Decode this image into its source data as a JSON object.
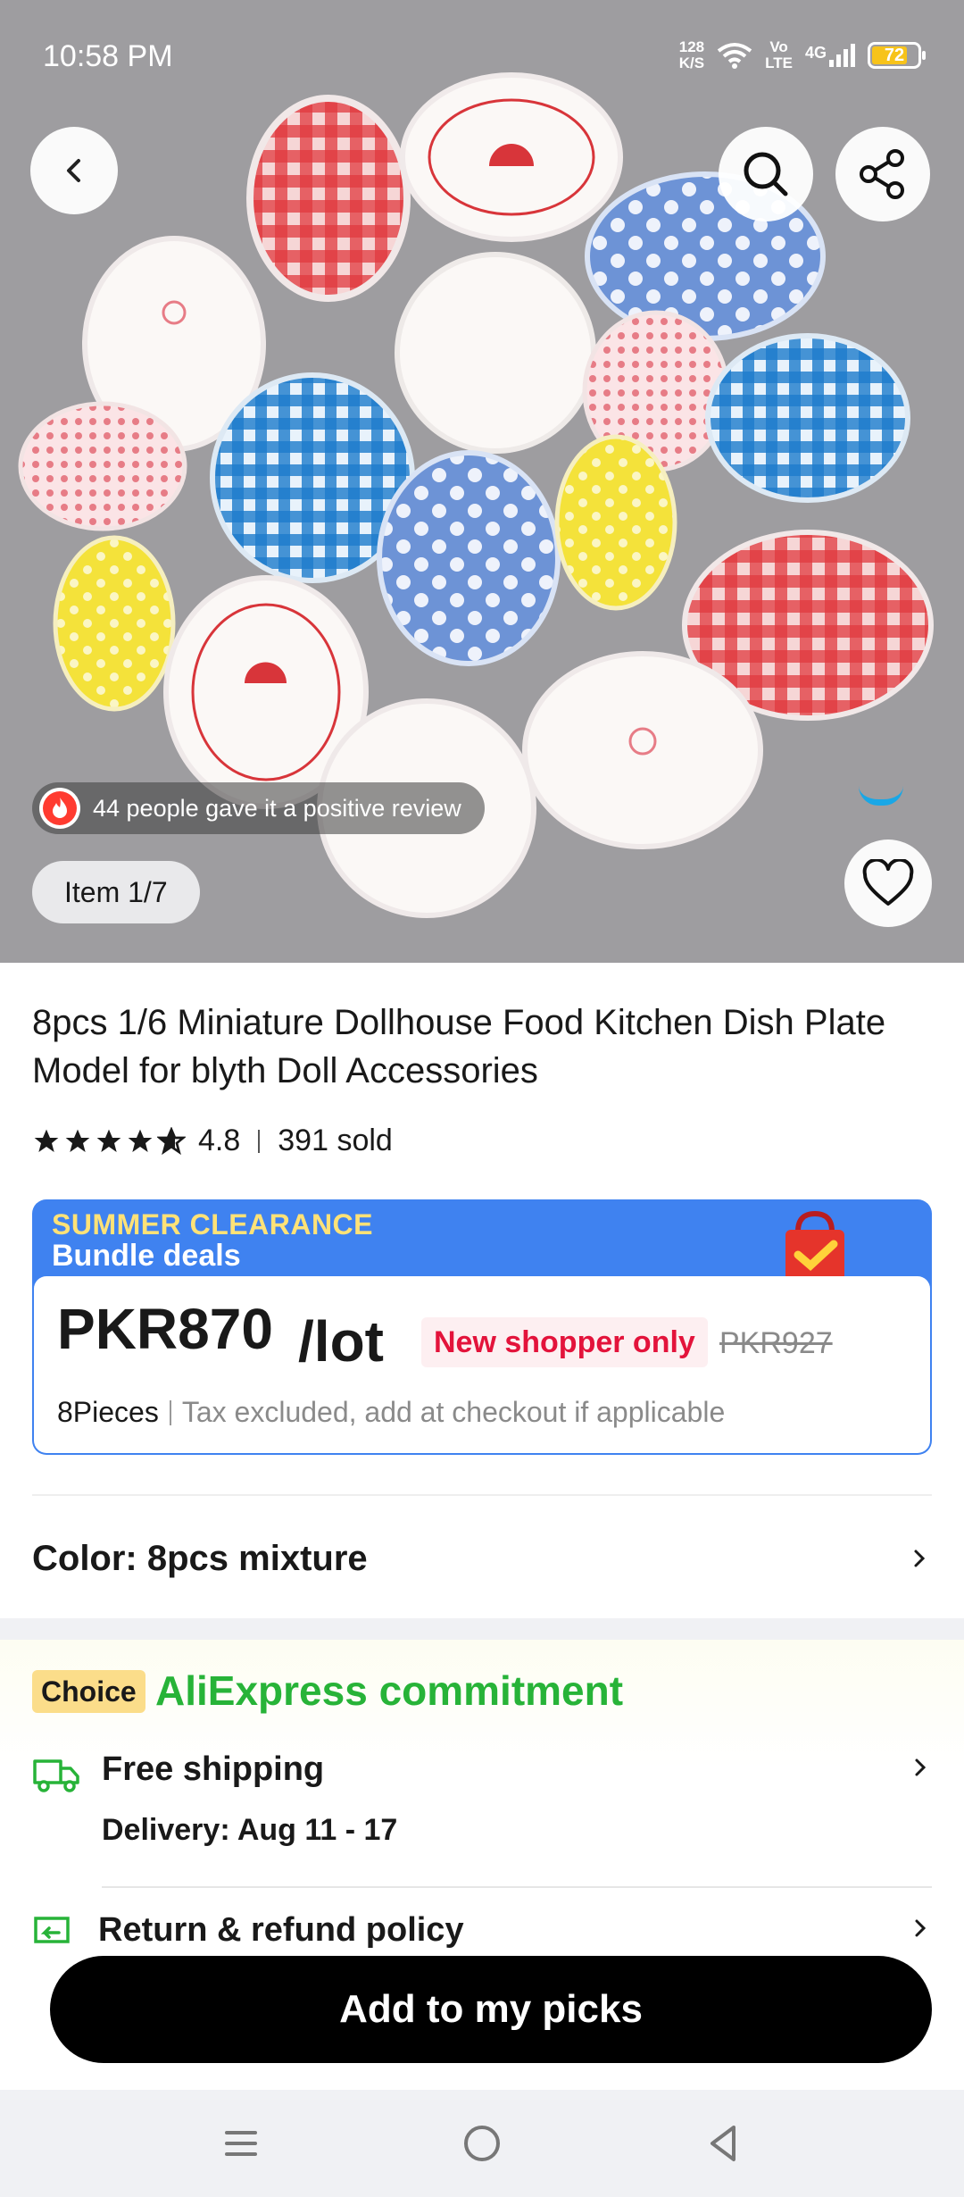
{
  "status_bar": {
    "time": "10:58 PM",
    "net_speed_value": "128",
    "net_speed_unit": "K/S",
    "volte_top": "Vo",
    "volte_bottom": "LTE",
    "network": "4G",
    "battery": "72"
  },
  "hero": {
    "review_text": "44 people gave it a positive review",
    "item_counter": "Item 1/7",
    "icons": [
      "back-icon",
      "search-icon",
      "share-icon",
      "heart-icon",
      "flame-icon"
    ]
  },
  "product": {
    "title": "8pcs 1/6 Miniature Dollhouse Food Kitchen Dish Plate Model for blyth  Doll Accessories",
    "rating": "4.8",
    "sold": "391 sold",
    "star_count_display": 4.8
  },
  "promo": {
    "line1": "SUMMER CLEARANCE",
    "line2": "Bundle deals",
    "price": "PKR870",
    "unit": "/lot",
    "badge": "New shopper only",
    "original_price": "PKR927",
    "pieces": "8Pieces",
    "tax_note": "Tax excluded, add at checkout if applicable"
  },
  "color_option": {
    "label": "Color: 8pcs mixture"
  },
  "commitment": {
    "badge": "Choice",
    "title": "AliExpress commitment",
    "shipping_title": "Free shipping",
    "delivery": "Delivery: Aug 11 - 17",
    "return_title": "Return & refund policy"
  },
  "cta": {
    "label": "Add to my picks"
  },
  "colors": {
    "accent_green": "#27b338",
    "promo_blue": "#3f82f0",
    "price_red": "#e3133b",
    "choice_yellow": "#fbdd8a"
  }
}
